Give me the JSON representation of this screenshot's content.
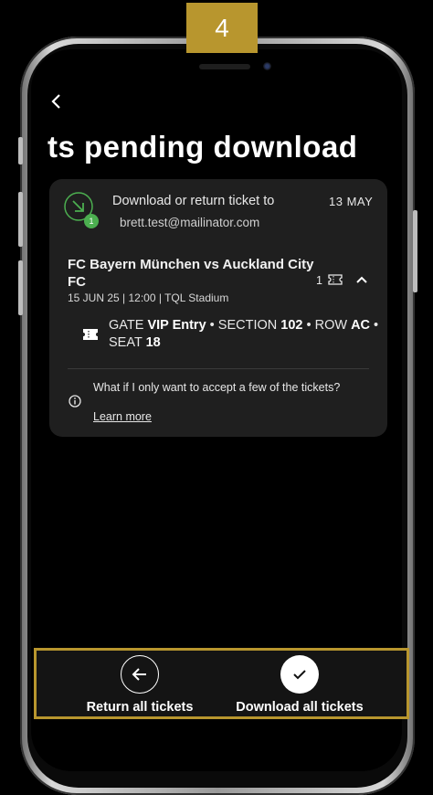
{
  "step_badge": "4",
  "page": {
    "title": "ts pending download"
  },
  "notice": {
    "text": "Download or return ticket to",
    "date": "13 MAY",
    "email": "brett.test@mailinator.com",
    "count": "1"
  },
  "event": {
    "name": "FC Bayern München vs Auckland City FC",
    "meta": "15 JUN 25 | 12:00 | TQL Stadium",
    "ticket_count": "1",
    "seat": {
      "gate_label": "GATE",
      "gate_value": "VIP Entry",
      "section_label": "SECTION",
      "section_value": "102",
      "row_label": "ROW",
      "row_value": "AC",
      "seat_label": "SEAT",
      "seat_value": "18"
    }
  },
  "faq": {
    "question": "What if I only want to accept a few of the tickets?",
    "link": "Learn more"
  },
  "actions": {
    "return_label": "Return all tickets",
    "download_label": "Download all tickets"
  },
  "colors": {
    "highlight": "#b8962e",
    "card_bg": "#1f1f1f",
    "success": "#4caf50"
  }
}
